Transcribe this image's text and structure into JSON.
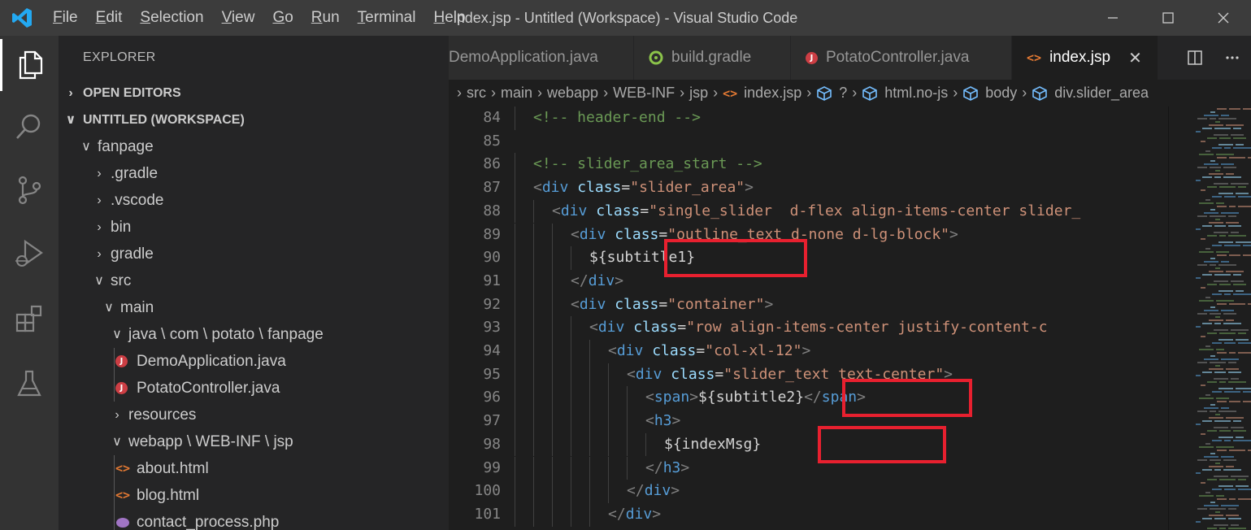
{
  "window": {
    "title": "index.jsp - Untitled (Workspace) - Visual Studio Code",
    "menu": [
      {
        "pre": "",
        "u": "F",
        "post": "ile"
      },
      {
        "pre": "",
        "u": "E",
        "post": "dit"
      },
      {
        "pre": "",
        "u": "S",
        "post": "election"
      },
      {
        "pre": "",
        "u": "V",
        "post": "iew"
      },
      {
        "pre": "",
        "u": "G",
        "post": "o"
      },
      {
        "pre": "",
        "u": "R",
        "post": "un"
      },
      {
        "pre": "",
        "u": "T",
        "post": "erminal"
      },
      {
        "pre": "",
        "u": "H",
        "post": "elp"
      }
    ]
  },
  "activity_bar": [
    "explorer-icon",
    "search-icon",
    "source-control-icon",
    "run-debug-icon",
    "extensions-icon",
    "testing-icon"
  ],
  "sidebar": {
    "title": "EXPLORER",
    "sections": {
      "open_editors": "OPEN EDITORS",
      "workspace": "UNTITLED (WORKSPACE)"
    },
    "tree": [
      {
        "label": "fanpage",
        "chev": "∨",
        "icon": "",
        "depth": 0
      },
      {
        "label": ".gradle",
        "chev": "›",
        "icon": "",
        "depth": 1
      },
      {
        "label": ".vscode",
        "chev": "›",
        "icon": "",
        "depth": 1
      },
      {
        "label": "bin",
        "chev": "›",
        "icon": "",
        "depth": 1
      },
      {
        "label": "gradle",
        "chev": "›",
        "icon": "",
        "depth": 1
      },
      {
        "label": "src",
        "chev": "∨",
        "icon": "",
        "depth": 1
      },
      {
        "label": "main",
        "chev": "∨",
        "icon": "",
        "depth": 2
      },
      {
        "label": "java \\ com \\ potato \\ fanpage",
        "chev": "∨",
        "icon": "",
        "depth": 3
      },
      {
        "label": "DemoApplication.java",
        "chev": "",
        "icon": "java",
        "depth": 4
      },
      {
        "label": "PotatoController.java",
        "chev": "",
        "icon": "java",
        "depth": 4
      },
      {
        "label": "resources",
        "chev": "›",
        "icon": "",
        "depth": 3
      },
      {
        "label": "webapp \\ WEB-INF \\ jsp",
        "chev": "∨",
        "icon": "",
        "depth": 3
      },
      {
        "label": "about.html",
        "chev": "",
        "icon": "html",
        "depth": 4
      },
      {
        "label": "blog.html",
        "chev": "",
        "icon": "html",
        "depth": 4
      },
      {
        "label": "contact_process.php",
        "chev": "",
        "icon": "php",
        "depth": 4
      }
    ]
  },
  "tabs": [
    {
      "label": "DemoApplication.java",
      "icon": "",
      "active": false
    },
    {
      "label": "build.gradle",
      "icon": "gradle",
      "active": false
    },
    {
      "label": "PotatoController.java",
      "icon": "java",
      "active": false
    },
    {
      "label": "index.jsp",
      "icon": "jsp",
      "active": true
    }
  ],
  "breadcrumb": [
    {
      "label": "src",
      "icon": ""
    },
    {
      "label": "main",
      "icon": ""
    },
    {
      "label": "webapp",
      "icon": ""
    },
    {
      "label": "WEB-INF",
      "icon": ""
    },
    {
      "label": "jsp",
      "icon": ""
    },
    {
      "label": "index.jsp",
      "icon": "jsp"
    },
    {
      "label": "?",
      "icon": "cube"
    },
    {
      "label": "html.no-js",
      "icon": "cube"
    },
    {
      "label": "body",
      "icon": "cube"
    },
    {
      "label": "div.slider_area",
      "icon": "cube"
    }
  ],
  "code_lines": [
    {
      "n": "84",
      "indent": 2,
      "tokens": [
        [
          "c-comment",
          "<!-- header-end -->"
        ]
      ]
    },
    {
      "n": "85",
      "indent": 0,
      "tokens": []
    },
    {
      "n": "86",
      "indent": 2,
      "tokens": [
        [
          "c-comment",
          "<!-- slider_area_start -->"
        ]
      ]
    },
    {
      "n": "87",
      "indent": 2,
      "tokens": [
        [
          "c-punc",
          "<"
        ],
        [
          "c-tag",
          "div"
        ],
        [
          "c-text",
          " "
        ],
        [
          "c-attr",
          "class"
        ],
        [
          "c-text",
          "="
        ],
        [
          "c-str",
          "\"slider_area\""
        ],
        [
          "c-punc",
          ">"
        ]
      ]
    },
    {
      "n": "88",
      "indent": 3,
      "tokens": [
        [
          "c-punc",
          "<"
        ],
        [
          "c-tag",
          "div"
        ],
        [
          "c-text",
          " "
        ],
        [
          "c-attr",
          "class"
        ],
        [
          "c-text",
          "="
        ],
        [
          "c-str",
          "\"single_slider  d-flex align-items-center slider_"
        ]
      ]
    },
    {
      "n": "89",
      "indent": 4,
      "tokens": [
        [
          "c-punc",
          "<"
        ],
        [
          "c-tag",
          "div"
        ],
        [
          "c-text",
          " "
        ],
        [
          "c-attr",
          "class"
        ],
        [
          "c-text",
          "="
        ],
        [
          "c-str",
          "\"outline_text d-none d-lg-block\""
        ],
        [
          "c-punc",
          ">"
        ]
      ]
    },
    {
      "n": "90",
      "indent": 5,
      "tokens": [
        [
          "c-text",
          "${subtitle1}"
        ]
      ]
    },
    {
      "n": "91",
      "indent": 4,
      "tokens": [
        [
          "c-punc",
          "</"
        ],
        [
          "c-tag",
          "div"
        ],
        [
          "c-punc",
          ">"
        ]
      ]
    },
    {
      "n": "92",
      "indent": 4,
      "tokens": [
        [
          "c-punc",
          "<"
        ],
        [
          "c-tag",
          "div"
        ],
        [
          "c-text",
          " "
        ],
        [
          "c-attr",
          "class"
        ],
        [
          "c-text",
          "="
        ],
        [
          "c-str",
          "\"container\""
        ],
        [
          "c-punc",
          ">"
        ]
      ]
    },
    {
      "n": "93",
      "indent": 5,
      "tokens": [
        [
          "c-punc",
          "<"
        ],
        [
          "c-tag",
          "div"
        ],
        [
          "c-text",
          " "
        ],
        [
          "c-attr",
          "class"
        ],
        [
          "c-text",
          "="
        ],
        [
          "c-str",
          "\"row align-items-center justify-content-c"
        ]
      ]
    },
    {
      "n": "94",
      "indent": 6,
      "tokens": [
        [
          "c-punc",
          "<"
        ],
        [
          "c-tag",
          "div"
        ],
        [
          "c-text",
          " "
        ],
        [
          "c-attr",
          "class"
        ],
        [
          "c-text",
          "="
        ],
        [
          "c-str",
          "\"col-xl-12\""
        ],
        [
          "c-punc",
          ">"
        ]
      ]
    },
    {
      "n": "95",
      "indent": 7,
      "tokens": [
        [
          "c-punc",
          "<"
        ],
        [
          "c-tag",
          "div"
        ],
        [
          "c-text",
          " "
        ],
        [
          "c-attr",
          "class"
        ],
        [
          "c-text",
          "="
        ],
        [
          "c-str",
          "\"slider_text text-center\""
        ],
        [
          "c-punc",
          ">"
        ]
      ]
    },
    {
      "n": "96",
      "indent": 8,
      "tokens": [
        [
          "c-punc",
          "<"
        ],
        [
          "c-tag",
          "span"
        ],
        [
          "c-punc",
          ">"
        ],
        [
          "c-text",
          "${subtitle2}"
        ],
        [
          "c-punc",
          "</"
        ],
        [
          "c-tag",
          "span"
        ],
        [
          "c-punc",
          ">"
        ]
      ]
    },
    {
      "n": "97",
      "indent": 8,
      "tokens": [
        [
          "c-punc",
          "<"
        ],
        [
          "c-tag",
          "h3"
        ],
        [
          "c-punc",
          ">"
        ]
      ]
    },
    {
      "n": "98",
      "indent": 9,
      "tokens": [
        [
          "c-text",
          "${indexMsg}"
        ]
      ]
    },
    {
      "n": "99",
      "indent": 8,
      "tokens": [
        [
          "c-punc",
          "</"
        ],
        [
          "c-tag",
          "h3"
        ],
        [
          "c-punc",
          ">"
        ]
      ]
    },
    {
      "n": "100",
      "indent": 7,
      "tokens": [
        [
          "c-punc",
          "</"
        ],
        [
          "c-tag",
          "div"
        ],
        [
          "c-punc",
          ">"
        ]
      ]
    },
    {
      "n": "101",
      "indent": 6,
      "tokens": [
        [
          "c-punc",
          "</"
        ],
        [
          "c-tag",
          "div"
        ],
        [
          "c-punc",
          ">"
        ]
      ]
    }
  ],
  "highlight_boxes": [
    "subtitle1",
    "subtitle2",
    "indexMsg"
  ],
  "colors": {
    "highlight": "#e8202f",
    "java_icon": "#cc3e44",
    "html_icon": "#e37933",
    "gradle_icon": "#8bc34a",
    "breadcrumb_symbol": "#75beff"
  }
}
